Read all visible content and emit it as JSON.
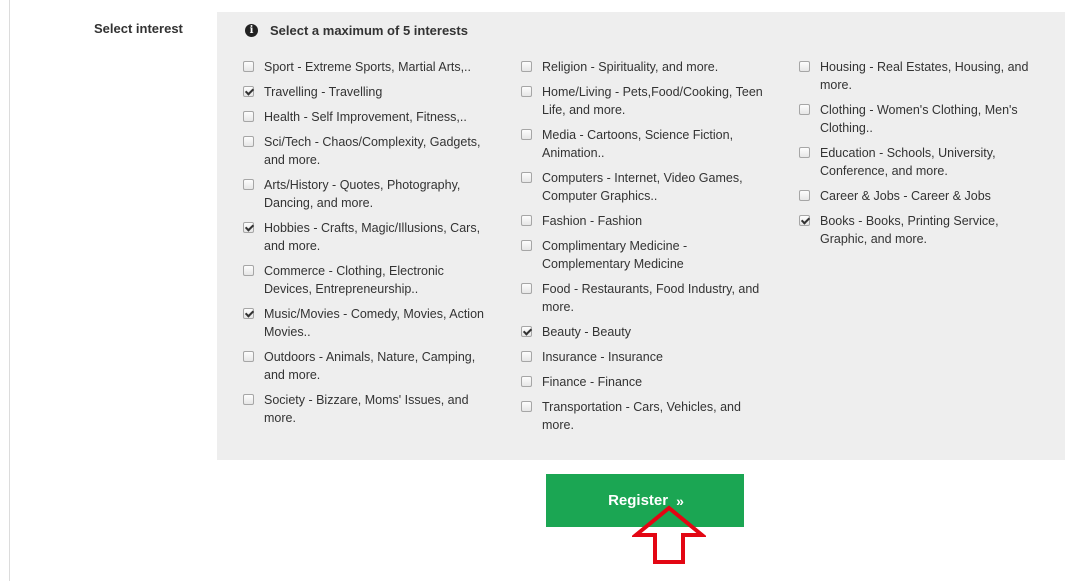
{
  "form": {
    "field_label": "Select interest",
    "hint": "Select a maximum of 5 interests",
    "columns": [
      [
        {
          "label": "Sport - Extreme Sports, Martial Arts,..",
          "checked": false
        },
        {
          "label": "Travelling - Travelling",
          "checked": true
        },
        {
          "label": "Health - Self Improvement, Fitness,..",
          "checked": false
        },
        {
          "label": "Sci/Tech - Chaos/Complexity, Gadgets, and more.",
          "checked": false
        },
        {
          "label": "Arts/History - Quotes, Photography, Dancing, and more.",
          "checked": false
        },
        {
          "label": "Hobbies - Crafts, Magic/Illusions, Cars, and more.",
          "checked": true
        },
        {
          "label": "Commerce - Clothing, Electronic Devices, Entrepreneurship..",
          "checked": false
        },
        {
          "label": "Music/Movies - Comedy, Movies, Action Movies..",
          "checked": true
        },
        {
          "label": "Outdoors - Animals, Nature, Camping, and more.",
          "checked": false
        },
        {
          "label": "Society - Bizzare, Moms' Issues, and more.",
          "checked": false
        }
      ],
      [
        {
          "label": "Religion - Spirituality, and more.",
          "checked": false
        },
        {
          "label": "Home/Living - Pets,Food/Cooking, Teen Life, and more.",
          "checked": false
        },
        {
          "label": "Media - Cartoons, Science Fiction, Animation..",
          "checked": false
        },
        {
          "label": "Computers - Internet, Video Games, Computer Graphics..",
          "checked": false
        },
        {
          "label": "Fashion - Fashion",
          "checked": false
        },
        {
          "label": "Complimentary Medicine - Complementary Medicine",
          "checked": false
        },
        {
          "label": "Food - Restaurants, Food Industry, and more.",
          "checked": false
        },
        {
          "label": "Beauty - Beauty",
          "checked": true
        },
        {
          "label": "Insurance - Insurance",
          "checked": false
        },
        {
          "label": "Finance - Finance",
          "checked": false
        },
        {
          "label": "Transportation - Cars, Vehicles, and more.",
          "checked": false
        }
      ],
      [
        {
          "label": "Housing - Real Estates, Housing, and more.",
          "checked": false
        },
        {
          "label": "Clothing - Women's Clothing, Men's Clothing..",
          "checked": false
        },
        {
          "label": "Education - Schools, University, Conference, and more.",
          "checked": false
        },
        {
          "label": "Career & Jobs - Career & Jobs",
          "checked": false
        },
        {
          "label": "Books - Books, Printing Service, Graphic, and more.",
          "checked": true
        }
      ]
    ]
  },
  "register_button": {
    "label": "Register",
    "chevron": "»",
    "color": "#1ba653"
  },
  "annotation": {
    "icon": "up-arrow-outline-icon",
    "color": "#e30613"
  },
  "icons": {
    "info": "info-circle-icon"
  }
}
